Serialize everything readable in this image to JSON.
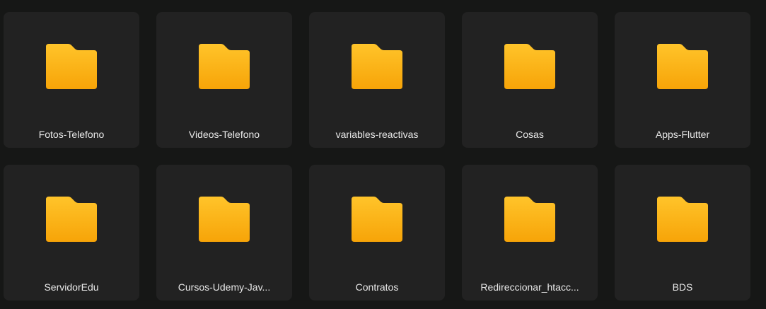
{
  "folders": [
    {
      "name": "Fotos-Telefono",
      "icon": "folder-icon"
    },
    {
      "name": "Videos-Telefono",
      "icon": "folder-icon"
    },
    {
      "name": "variables-reactivas",
      "icon": "folder-icon"
    },
    {
      "name": "Cosas",
      "icon": "folder-icon"
    },
    {
      "name": "Apps-Flutter",
      "icon": "folder-icon"
    },
    {
      "name": "ServidorEdu",
      "icon": "folder-icon"
    },
    {
      "name": "Cursos-Udemy-Jav...",
      "icon": "folder-icon"
    },
    {
      "name": "Contratos",
      "icon": "folder-icon"
    },
    {
      "name": "Redireccionar_htacc...",
      "icon": "folder-icon"
    },
    {
      "name": "BDS",
      "icon": "folder-icon"
    }
  ],
  "colors": {
    "background": "#161716",
    "tile": "#222222",
    "folder_top": "#FFC42A",
    "folder_bottom": "#F7A408",
    "label": "#E9E9E9"
  }
}
